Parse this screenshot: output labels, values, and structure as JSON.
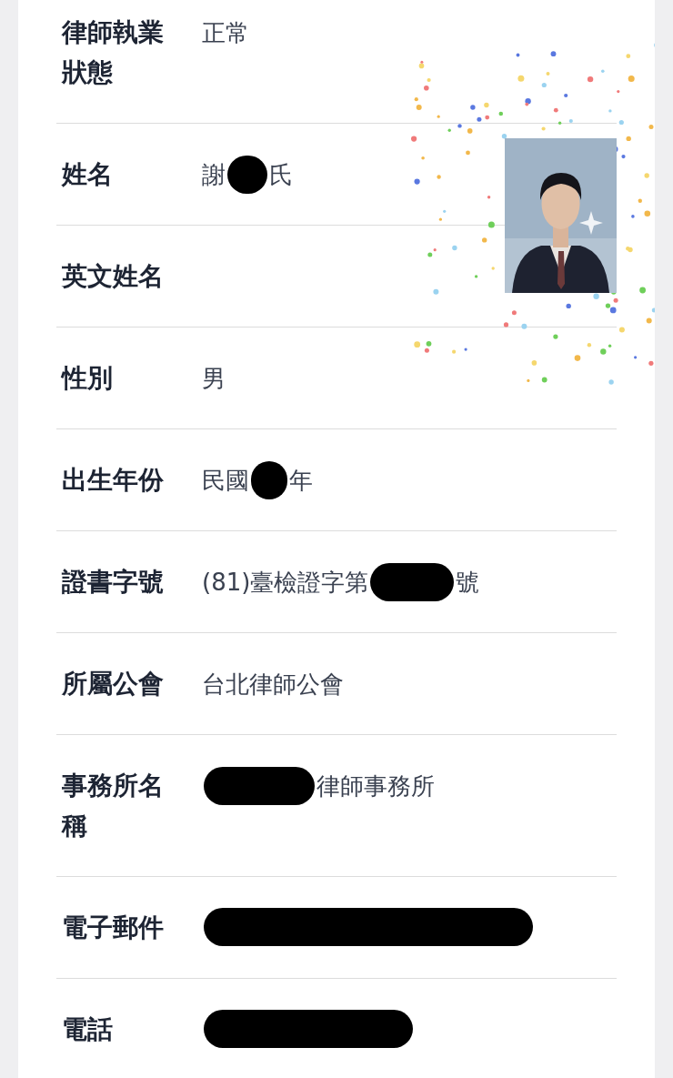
{
  "rows": [
    {
      "label": "律師執業狀態",
      "value": [
        {
          "kind": "text",
          "text": "正常"
        }
      ]
    },
    {
      "label": "姓名",
      "value": [
        {
          "kind": "text",
          "text": "謝"
        },
        {
          "kind": "redaction"
        },
        {
          "kind": "text",
          "text": "氏"
        }
      ]
    },
    {
      "label": "英文姓名",
      "value": []
    },
    {
      "label": "性別",
      "value": [
        {
          "kind": "text",
          "text": "男"
        }
      ]
    },
    {
      "label": "出生年份",
      "value": [
        {
          "kind": "text",
          "text": "民國"
        },
        {
          "kind": "redaction"
        },
        {
          "kind": "text",
          "text": "年"
        }
      ]
    },
    {
      "label": "證書字號",
      "value": [
        {
          "kind": "text",
          "text": "(81)臺檢證字第"
        },
        {
          "kind": "redaction"
        },
        {
          "kind": "text",
          "text": "號"
        }
      ]
    },
    {
      "label": "所屬公會",
      "value": [
        {
          "kind": "text",
          "text": "台北律師公會"
        }
      ]
    },
    {
      "label": "事務所名稱",
      "value": [
        {
          "kind": "redaction"
        },
        {
          "kind": "text",
          "text": "律師事務所"
        }
      ]
    },
    {
      "label": "電子郵件",
      "value": [
        {
          "kind": "redaction"
        }
      ]
    },
    {
      "label": "電話",
      "value": [
        {
          "kind": "redaction"
        }
      ]
    }
  ]
}
